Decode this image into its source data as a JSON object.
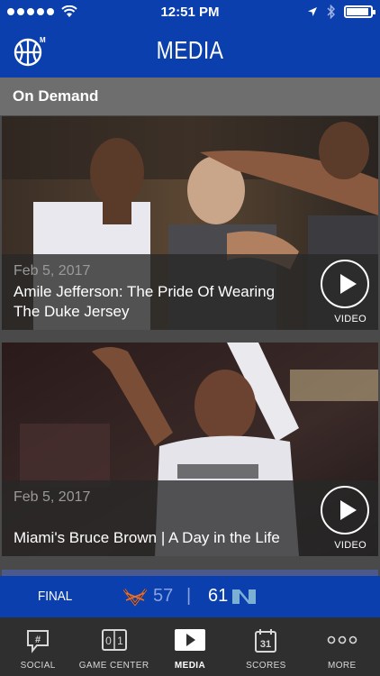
{
  "status_bar": {
    "time": "12:51 PM",
    "signal_dots": 5
  },
  "nav": {
    "title": "MEDIA",
    "logo_icon": "basketball-icon",
    "logo_badge": "M"
  },
  "section": {
    "title": "On Demand"
  },
  "cards": [
    {
      "date": "Feb 5, 2017",
      "headline": "Amile Jefferson: The Pride Of Wearing The Duke Jersey",
      "media_label": "VIDEO"
    },
    {
      "date": "Feb 5, 2017",
      "headline": "Miami's Bruce Brown | A Day in the Life",
      "media_label": "VIDEO"
    }
  ],
  "score": {
    "status": "FINAL",
    "away_score": "57",
    "separator": "|",
    "home_score": "61"
  },
  "tabs": [
    {
      "label": "SOCIAL",
      "icon": "hashtag-bubble-icon"
    },
    {
      "label": "GAME CENTER",
      "icon": "scoreboard-icon",
      "icon_text": "0 1"
    },
    {
      "label": "MEDIA",
      "icon": "play-icon"
    },
    {
      "label": "SCORES",
      "icon": "calendar-icon",
      "icon_text": "31"
    },
    {
      "label": "MORE",
      "icon": "more-icon"
    }
  ],
  "colors": {
    "brand_blue": "#0b3fae",
    "section_gray": "#6e6e6e",
    "tabbar": "#2f2f2f"
  }
}
